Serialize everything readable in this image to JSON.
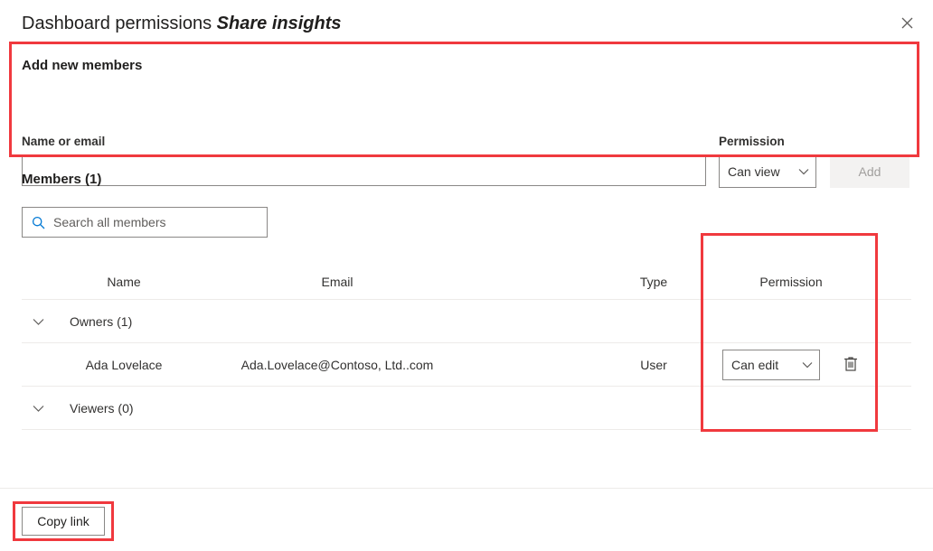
{
  "dialog": {
    "title_main": "Dashboard permissions",
    "title_italic": "Share insights",
    "close_icon": "close-icon"
  },
  "add_members": {
    "section_title": "Add new members",
    "name_label": "Name or email",
    "name_value": "",
    "name_placeholder": "",
    "permission_label": "Permission",
    "permission_value": "Can view",
    "add_button": "Add",
    "add_button_disabled": true
  },
  "members": {
    "heading": "Members (1)",
    "search_placeholder": "Search all members",
    "search_value": "",
    "search_icon": "search-icon",
    "columns": {
      "name": "Name",
      "email": "Email",
      "type": "Type",
      "permission": "Permission"
    },
    "groups": [
      {
        "label": "Owners (1)",
        "chevron": "chevron-down-icon",
        "rows": [
          {
            "name": "Ada Lovelace",
            "email": "Ada.Lovelace@Contoso, Ltd..com",
            "type": "User",
            "permission": "Can edit",
            "delete_icon": "trash-icon"
          }
        ]
      },
      {
        "label": "Viewers (0)",
        "chevron": "chevron-down-icon",
        "rows": []
      }
    ]
  },
  "footer": {
    "copy_link": "Copy link"
  },
  "colors": {
    "annotation": "#f0393e",
    "accent": "#0078d4",
    "text": "#323130",
    "border": "#8a8886",
    "rule": "#edebe9",
    "disabled_bg": "#f3f2f1",
    "disabled_text": "#a19f9d"
  }
}
